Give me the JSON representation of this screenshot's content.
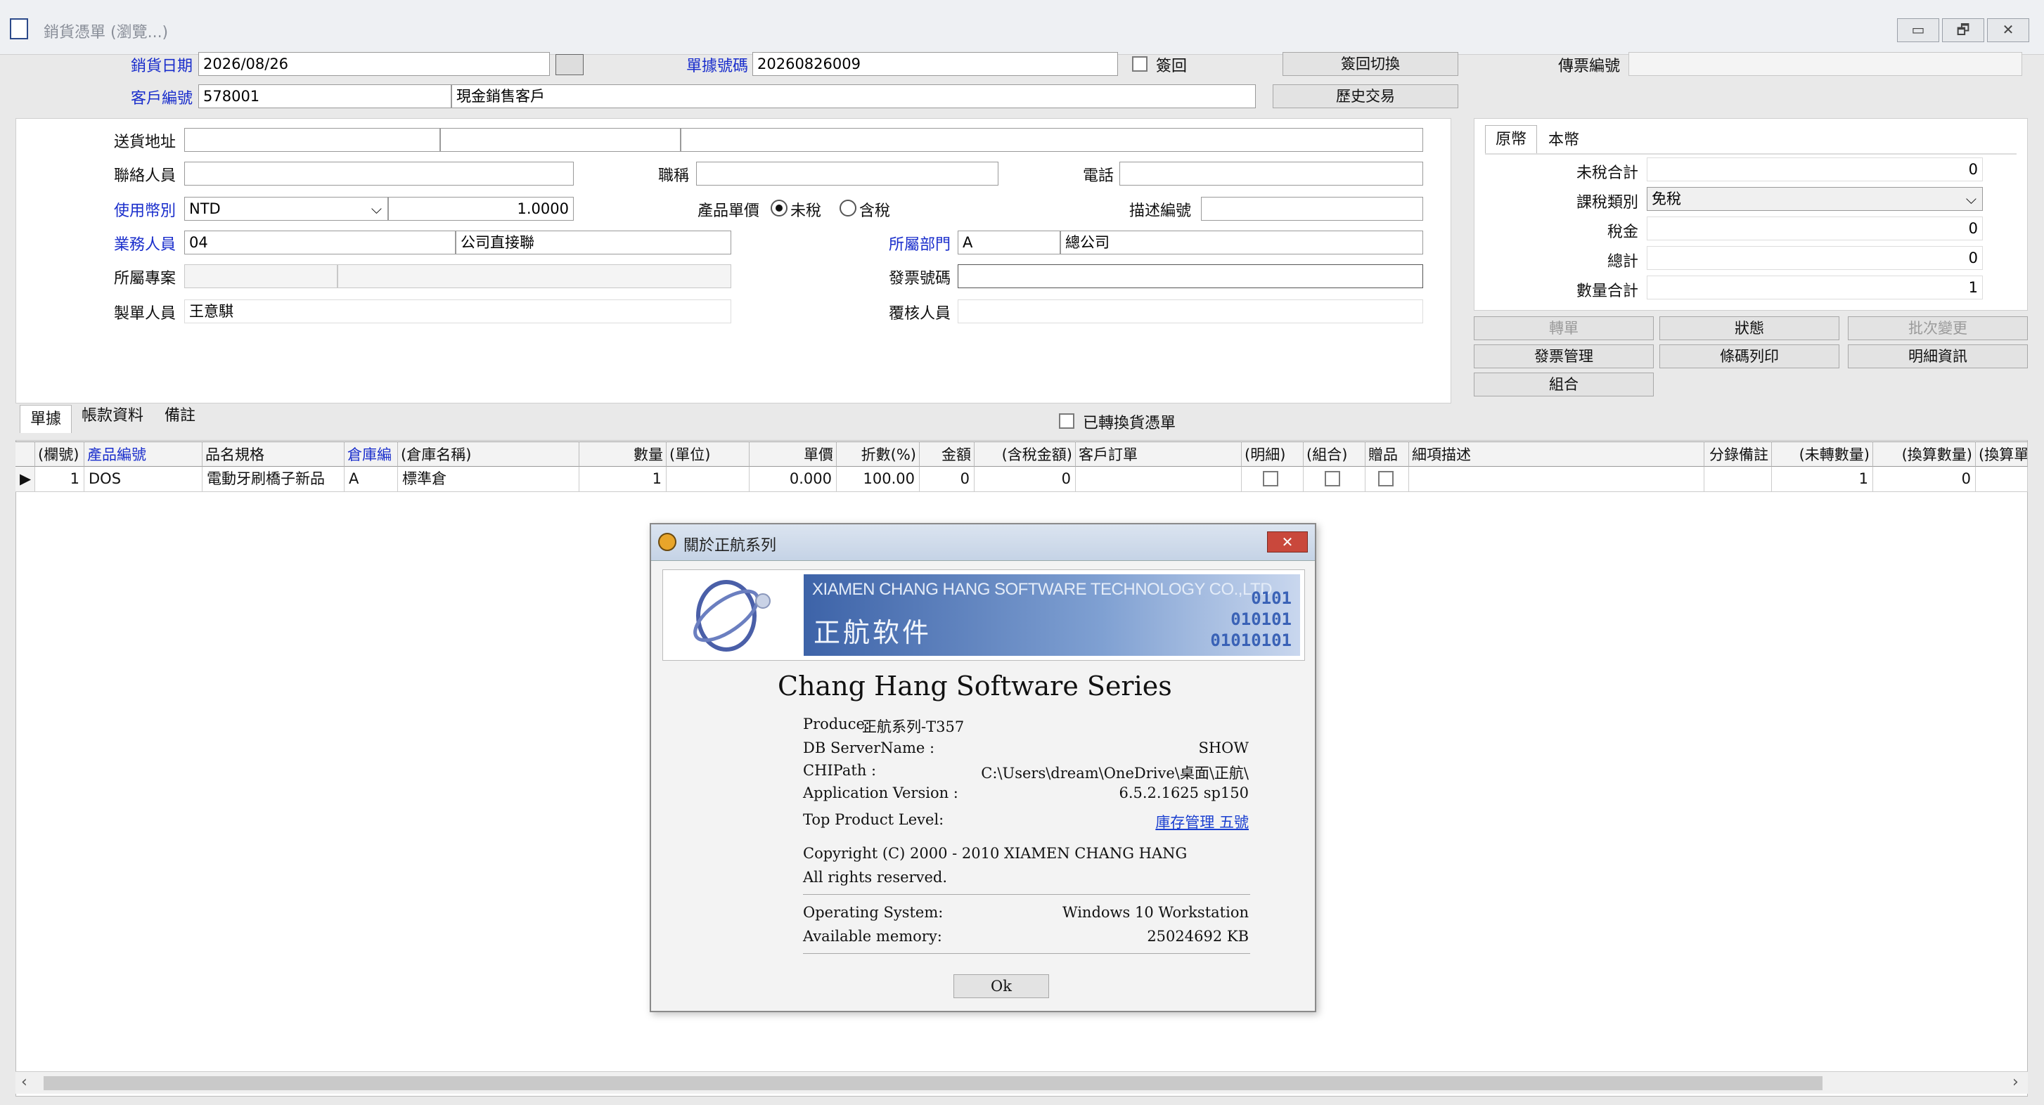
{
  "window": {
    "title": "銷貨憑單 (瀏覽...)",
    "controls": [
      "▭",
      "🗗",
      "✕"
    ]
  },
  "header": {
    "date_label": "銷貨日期",
    "date_value": "2026/08/26",
    "docno_label": "單據號碼",
    "docno_value": "20260826009",
    "signback_label": "簽回",
    "signback_switch": "簽回切換",
    "voucher_label": "傳票編號",
    "voucher_value": "",
    "customer_label": "客戶編號",
    "customer_code": "578001",
    "customer_name": "現金銷售客戶",
    "history_button": "歷史交易"
  },
  "form": {
    "ship_addr_label": "送貨地址",
    "contact_label": "聯絡人員",
    "title_label": "職稱",
    "phone_label": "電話",
    "currency_label": "使用幣別",
    "currency_value": "NTD",
    "rate_value": "1.0000",
    "price_label": "產品單價",
    "price_opt_excl": "未稅",
    "price_opt_incl": "含稅",
    "desc_code_label": "描述編號",
    "sales_label": "業務人員",
    "sales_code": "04",
    "sales_name": "公司直接聯",
    "dept_label": "所屬部門",
    "dept_code": "A",
    "dept_name": "總公司",
    "project_label": "所屬專案",
    "invoice_label": "發票號碼",
    "maker_label": "製單人員",
    "maker_value": "王意騏",
    "reviewer_label": "覆核人員"
  },
  "summary": {
    "tab_orig": "原幣",
    "tab_local": "本幣",
    "pretax_label": "未稅合計",
    "pretax_value": "0",
    "taxtype_label": "課稅類別",
    "taxtype_value": "免稅",
    "tax_label": "稅金",
    "tax_value": "0",
    "total_label": "總計",
    "total_value": "0",
    "qty_label": "數量合計",
    "qty_value": "1"
  },
  "actions": {
    "transfer": "轉單",
    "status": "狀態",
    "batch_change": "批次變更",
    "invoice_mgmt": "發票管理",
    "barcode_print": "條碼列印",
    "detail_info": "明細資訊",
    "combine": "組合"
  },
  "tabs": [
    "單據",
    "帳款資料",
    "備註"
  ],
  "converted_label": "已轉換貨憑單",
  "grid": {
    "headers": [
      "(欄號)",
      "產品編號",
      "品名規格",
      "倉庫編",
      "(倉庫名稱)",
      "數量",
      "(單位)",
      "單價",
      "折數(%)",
      "金額",
      "(含稅金額)",
      "客戶訂單",
      "(明細)",
      "(組合)",
      "贈品",
      "細項描述",
      "分錄備註",
      "(未轉數量)",
      "(換算數量)",
      "(換算單"
    ],
    "row": {
      "no": "1",
      "product": "DOS",
      "name": "電動牙刷橋子新品",
      "wh_code": "A",
      "wh_name": "標準倉",
      "qty": "1",
      "unit": "",
      "price": "0.000",
      "discount": "100.00",
      "amount": "0",
      "amount_tax": "0",
      "unconverted": "1",
      "converted": "0"
    }
  },
  "dialog": {
    "title": "關於正航系列",
    "banner_en": "XIAMEN CHANG HANG SOFTWARE TECHNOLOGY CO.,LTD.",
    "banner_cn": "正航软件",
    "banner_bits": [
      "0101",
      "010101",
      "01010101"
    ],
    "heading": "Chang Hang Software Series",
    "produce_label": "Produce:",
    "produce_value": "正航系列-T357",
    "db_label": "DB ServerName :",
    "db_value": "SHOW",
    "chipath_label": "CHIPath :",
    "chipath_value": "C:\\Users\\dream\\OneDrive\\桌面\\正航\\",
    "appver_label": "Application Version :",
    "appver_value": "6.5.2.1625  sp150",
    "toplevel_label": "Top Product Level:",
    "toplevel_value": "庫存管理 五號",
    "copyright": "Copyright (C) 2000 - 2010 XIAMEN CHANG HANG",
    "rights": "All rights reserved.",
    "os_label": "Operating System:",
    "os_value": "Windows 10 Workstation",
    "mem_label": "Available memory:",
    "mem_value": "25024692 KB",
    "ok_button": "Ok"
  },
  "colors": {
    "accent_label": "#1a2ecc",
    "dialog_title": "#c5d3e6",
    "banner": "#5a7fb8"
  }
}
